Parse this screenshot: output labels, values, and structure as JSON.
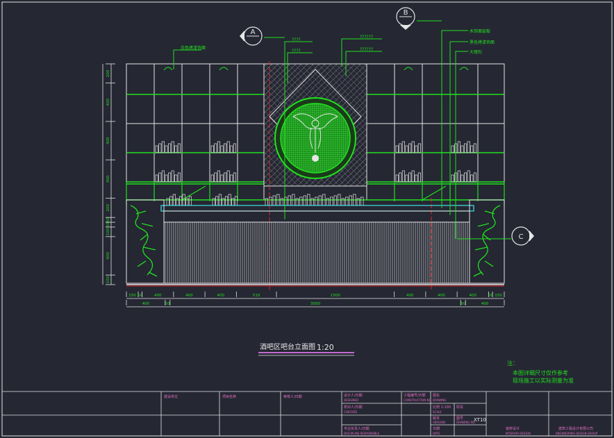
{
  "drawing": {
    "title": "酒吧区吧台立面图",
    "scale": "1:20",
    "sheet_no": "XT10"
  },
  "callouts": {
    "section_a": "A",
    "section_b": "B",
    "section_c": "C"
  },
  "top_labels": {
    "left_tag": "白色烤漆饰面",
    "q1": "????",
    "q2": "????",
    "q3": "??????",
    "q4": "??????",
    "r1": "木饰面层板",
    "r2": "黑色烤漆饰面",
    "r3": "大理石"
  },
  "dimensions": {
    "bottom_row1": [
      "150",
      "50",
      "400",
      "400",
      "400",
      "510",
      "1500",
      "400",
      "400",
      "400",
      "50",
      "150"
    ],
    "bottom_row2": [
      "400",
      "50",
      "3000",
      "50",
      "400"
    ],
    "left_col": [
      "200",
      "400",
      "400",
      "400",
      "200",
      "50",
      "50",
      "100",
      "400",
      "100"
    ]
  },
  "notes": {
    "label": "注：",
    "line1": "本图详细尺寸仅作参考",
    "line2": "现场施工以实际测量为准"
  },
  "title_block": {
    "c1": "建设单位",
    "c2": "项目名称",
    "c3": "审核人/日期",
    "designer": "设计人/日期",
    "designer_en": "DESIGNED",
    "checker": "校对人/日期",
    "checker_en": "CHECKED",
    "approver": "专业负责人/日期",
    "approver_en": "DISCIPLINE RESPONSIBLE",
    "proj_no": "工程编号/日期",
    "proj_no_en": "CONSTRUCTION NO.",
    "drawing_name": "图名",
    "drawing_name_en": "DRAWING",
    "scale_label": "比例 1:100",
    "scale_en": "SCALE",
    "stage": "阶段",
    "stage_en": "STAGE",
    "version": "版本",
    "version_en": "VERSION",
    "date": "日期",
    "date_en": "DATE",
    "sheet_label": "图号",
    "sheet_en": "DRAWING NO.",
    "firm": "装修设计",
    "firm_en": "INTERIOR DESIGN",
    "company": "建筑工程设计有限公司",
    "company_en": "ENGINEERING DESIGN GROUP"
  },
  "colors": {
    "background": "#252733",
    "green": "#21e21f",
    "white": "#e6e6e6",
    "cyan": "#3ee6e6",
    "red": "#e02626",
    "magenta": "#c46ad0"
  }
}
